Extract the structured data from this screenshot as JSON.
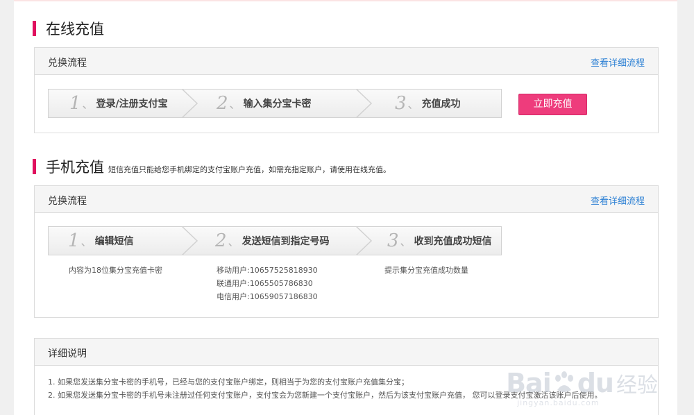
{
  "online": {
    "title": "在线充值",
    "box_title": "兑换流程",
    "detail_link": "查看详细流程",
    "steps": [
      {
        "num": "1",
        "sep": "、",
        "label": "登录/注册支付宝"
      },
      {
        "num": "2",
        "sep": "、",
        "label": "输入集分宝卡密"
      },
      {
        "num": "3",
        "sep": "、",
        "label": "充值成功"
      }
    ],
    "charge_button": "立即充值"
  },
  "mobile": {
    "title": "手机充值",
    "subtitle": "短信充值只能给您手机绑定的支付宝账户充值，如需充指定账户，请使用在线充值。",
    "box_title": "兑换流程",
    "detail_link": "查看详细流程",
    "steps": [
      {
        "num": "1",
        "sep": "、",
        "label": "编辑短信"
      },
      {
        "num": "2",
        "sep": "、",
        "label": "发送短信到指定号码"
      },
      {
        "num": "3",
        "sep": "、",
        "label": "收到充值成功短信"
      }
    ],
    "step1_desc": "内容为18位集分宝充值卡密",
    "step2_desc": [
      "移动用户:10657525818930",
      "联通用户:1065505786830",
      "电信用户:10659057186830"
    ],
    "step3_desc": "提示集分宝充值成功数量"
  },
  "details": {
    "box_title": "详细说明",
    "items": [
      "1. 如果您发送集分宝卡密的手机号，已经与您的支付宝账户绑定，则相当于为您的支付宝账户充值集分宝；",
      "2. 如果您发送集分宝卡密的手机号未注册过任何支付宝账户，支付宝会为您新建一个支付宝账户，然后为该支付宝账户充值， 您可以登录支付宝激活该账户后使用。"
    ]
  },
  "watermark": {
    "brand_a": "Bai",
    "brand_b": "du",
    "brand_cn": "经验",
    "url": "jingyan.baidu.com"
  },
  "colors": {
    "accent": "#e0105e",
    "button": "#ee3c7c",
    "link": "#2a7fd4"
  }
}
